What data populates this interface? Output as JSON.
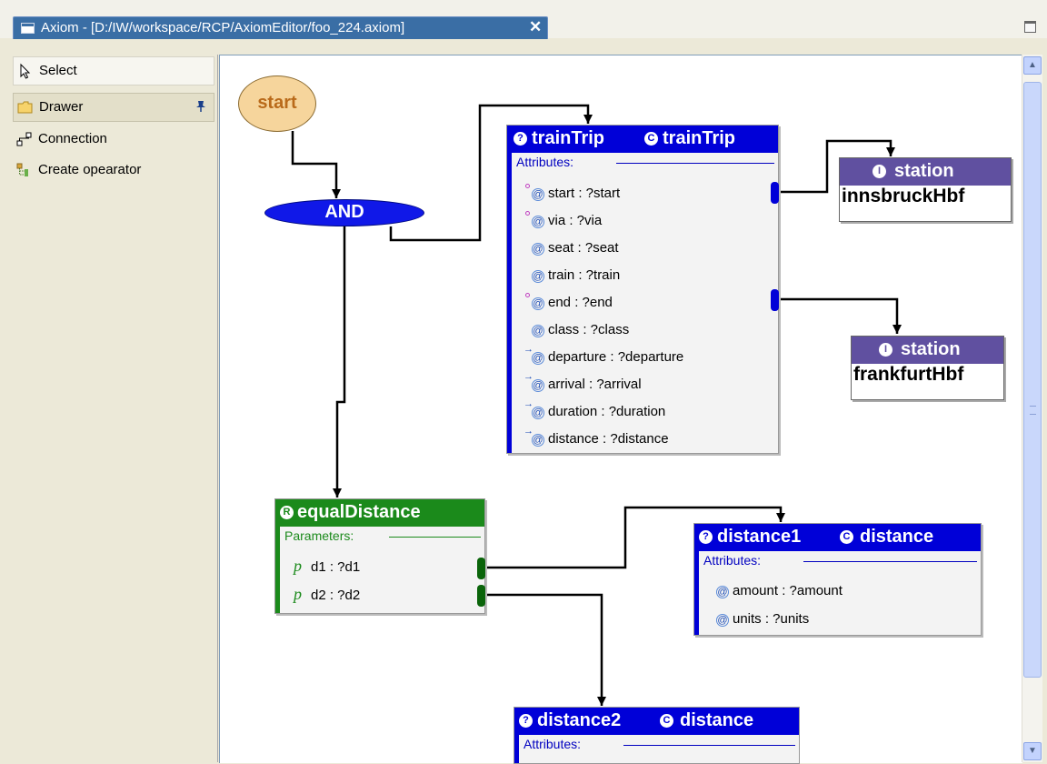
{
  "window": {
    "tab_title": "Axiom - [D:/IW/workspace/RCP/AxiomEditor/foo_224.axiom]",
    "close_glyph": "✕"
  },
  "palette": {
    "items": [
      {
        "label": "Select",
        "icon": "arrow-cursor-icon"
      },
      {
        "label": "Drawer",
        "icon": "folder-icon",
        "pin_icon": "pin-icon"
      },
      {
        "label": "Connection",
        "icon": "connection-icon"
      },
      {
        "label": "Create opearator",
        "icon": "tree-icon"
      }
    ]
  },
  "diagram": {
    "start": {
      "label": "start"
    },
    "and": {
      "label": "AND"
    },
    "trainTrip": {
      "badge_left": "?",
      "name": "trainTrip",
      "badge_right": "C",
      "concept": "trainTrip",
      "section": "Attributes:",
      "attributes": [
        {
          "text": "start : ?start",
          "marker": "dot"
        },
        {
          "text": "via : ?via",
          "marker": "dot"
        },
        {
          "text": "seat : ?seat",
          "marker": ""
        },
        {
          "text": "train : ?train",
          "marker": ""
        },
        {
          "text": "end : ?end",
          "marker": "dot"
        },
        {
          "text": "class : ?class",
          "marker": ""
        },
        {
          "text": "departure : ?departure",
          "marker": "arrow"
        },
        {
          "text": "arrival : ?arrival",
          "marker": "arrow"
        },
        {
          "text": "duration : ?duration",
          "marker": "arrow"
        },
        {
          "text": "distance : ?distance",
          "marker": "arrow"
        }
      ]
    },
    "station1": {
      "badge": "I",
      "concept": "station",
      "name": "innsbruckHbf"
    },
    "station2": {
      "badge": "I",
      "concept": "station",
      "name": "frankfurtHbf"
    },
    "equalDistance": {
      "badge": "R",
      "name": "equalDistance",
      "section": "Parameters:",
      "param_marker": "p",
      "params": [
        "d1 : ?d1",
        "d2 : ?d2"
      ]
    },
    "distance1": {
      "badge_left": "?",
      "name": "distance1",
      "badge_right": "C",
      "concept": "distance",
      "section": "Attributes:",
      "attributes": [
        "amount : ?amount",
        "units : ?units"
      ]
    },
    "distance2": {
      "badge_left": "?",
      "name": "distance2",
      "badge_right": "C",
      "concept": "distance",
      "section": "Attributes:"
    },
    "at_glyph": "@"
  },
  "colors": {
    "instance_header": "#0000d8",
    "relation_header": "#1b8a1b",
    "station_header": "#6050a0",
    "start_fill": "#f6d59c",
    "and_fill": "#1018e8"
  }
}
